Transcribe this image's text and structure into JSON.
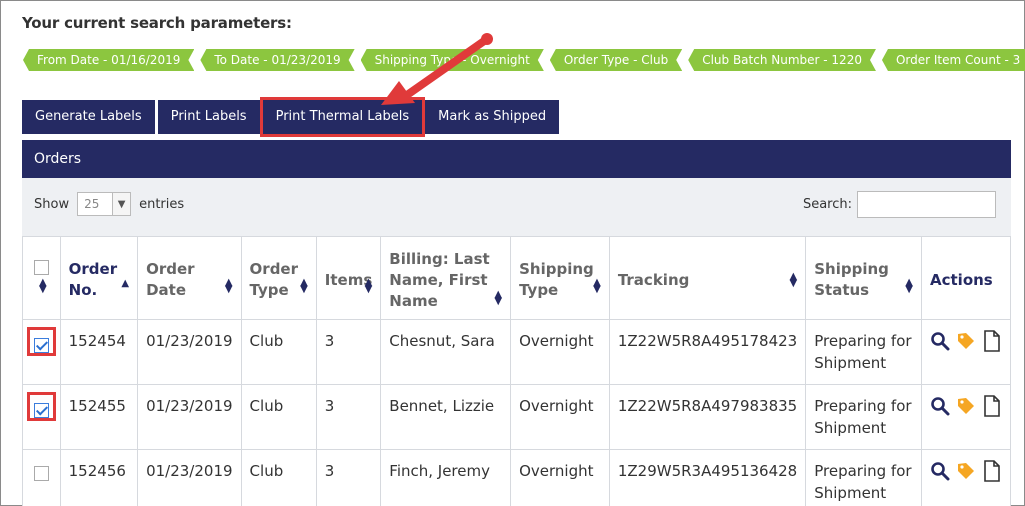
{
  "heading": "Your current search parameters:",
  "tags": [
    "From Date - 01/16/2019",
    "To Date - 01/23/2019",
    "Shipping Type - Overnight",
    "Order Type - Club",
    "Club Batch Number - 1220",
    "Order Item Count - 3"
  ],
  "buttons": {
    "generate": "Generate Labels",
    "print": "Print Labels",
    "print_thermal": "Print Thermal Labels",
    "mark_shipped": "Mark as Shipped"
  },
  "panel_title": "Orders",
  "show": {
    "label_before": "Show",
    "value": "25",
    "label_after": "entries"
  },
  "search_label": "Search:",
  "columns": {
    "order_no": "Order No.",
    "order_date": "Order Date",
    "order_type": "Order Type",
    "items": "Items",
    "billing": "Billing: Last Name, First Name",
    "shipping_type": "Shipping Type",
    "tracking": "Tracking",
    "shipping_status": "Shipping Status",
    "actions": "Actions"
  },
  "rows": [
    {
      "checked": true,
      "order_no": "152454",
      "order_date": "01/23/2019",
      "order_type": "Club",
      "items": "3",
      "billing": "Chesnut, Sara",
      "shipping_type": "Overnight",
      "tracking": "1Z22W5R8A495178423",
      "status": "Preparing for Shipment"
    },
    {
      "checked": true,
      "order_no": "152455",
      "order_date": "01/23/2019",
      "order_type": "Club",
      "items": "3",
      "billing": "Bennet, Lizzie",
      "shipping_type": "Overnight",
      "tracking": "1Z22W5R8A497983835",
      "status": "Preparing for Shipment"
    },
    {
      "checked": false,
      "order_no": "152456",
      "order_date": "01/23/2019",
      "order_type": "Club",
      "items": "3",
      "billing": "Finch, Jeremy",
      "shipping_type": "Overnight",
      "tracking": "1Z29W5R3A495136428",
      "status": "Preparing for Shipment"
    }
  ],
  "colors": {
    "navy": "#252a63",
    "green": "#8cc63f",
    "highlight": "#e03a3a",
    "tag_orange": "#f5a623"
  }
}
